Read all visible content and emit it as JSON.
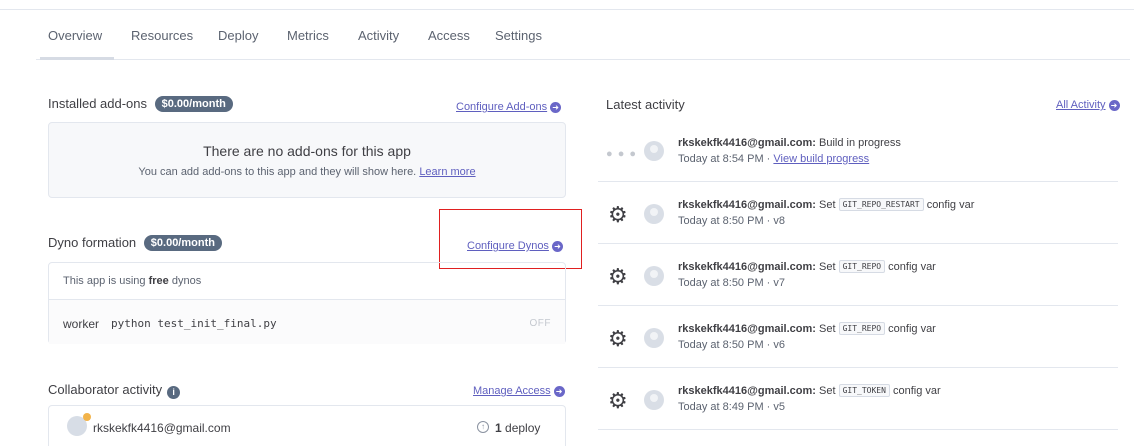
{
  "tabs": [
    "Overview",
    "Resources",
    "Deploy",
    "Metrics",
    "Activity",
    "Access",
    "Settings"
  ],
  "addons": {
    "title": "Installed add-ons",
    "badge": "$0.00/month",
    "link": "Configure Add-ons",
    "empty_title": "There are no add-ons for this app",
    "empty_sub": "You can add add-ons to this app and they will show here.",
    "learn_more": "Learn more"
  },
  "dynos": {
    "title": "Dyno formation",
    "badge": "$0.00/month",
    "link": "Configure Dynos",
    "note_prefix": "This app is using",
    "note_bold": "free",
    "note_suffix": "dynos",
    "type": "worker",
    "command": "python test_init_final.py",
    "status": "OFF"
  },
  "collaborators": {
    "title": "Collaborator activity",
    "link": "Manage Access",
    "email": "rkskekfk4416@gmail.com",
    "deploy_count": "1",
    "deploy_label": "deploy"
  },
  "activity": {
    "title": "Latest activity",
    "link": "All Activity",
    "items": [
      {
        "user": "rkskekfk4416@gmail.com:",
        "action": "Build in progress",
        "var": "",
        "suffix": "",
        "time": "Today at 8:54 PM",
        "version": "",
        "time_link": "View build progress",
        "icon": "dots-icon"
      },
      {
        "user": "rkskekfk4416@gmail.com:",
        "action": "Set",
        "var": "GIT_REPO_RESTART",
        "suffix": "config var",
        "time": "Today at 8:50 PM",
        "version": "v8",
        "time_link": "",
        "icon": "gear-icon"
      },
      {
        "user": "rkskekfk4416@gmail.com:",
        "action": "Set",
        "var": "GIT_REPO",
        "suffix": "config var",
        "time": "Today at 8:50 PM",
        "version": "v7",
        "time_link": "",
        "icon": "gear-icon"
      },
      {
        "user": "rkskekfk4416@gmail.com:",
        "action": "Set",
        "var": "GIT_REPO",
        "suffix": "config var",
        "time": "Today at 8:50 PM",
        "version": "v6",
        "time_link": "",
        "icon": "gear-icon"
      },
      {
        "user": "rkskekfk4416@gmail.com:",
        "action": "Set",
        "var": "GIT_TOKEN",
        "suffix": "config var",
        "time": "Today at 8:49 PM",
        "version": "v5",
        "time_link": "",
        "icon": "gear-icon"
      }
    ]
  },
  "colors": {
    "accent": "#5f5fbf",
    "badge": "#596a80",
    "highlight": "#e02020"
  }
}
